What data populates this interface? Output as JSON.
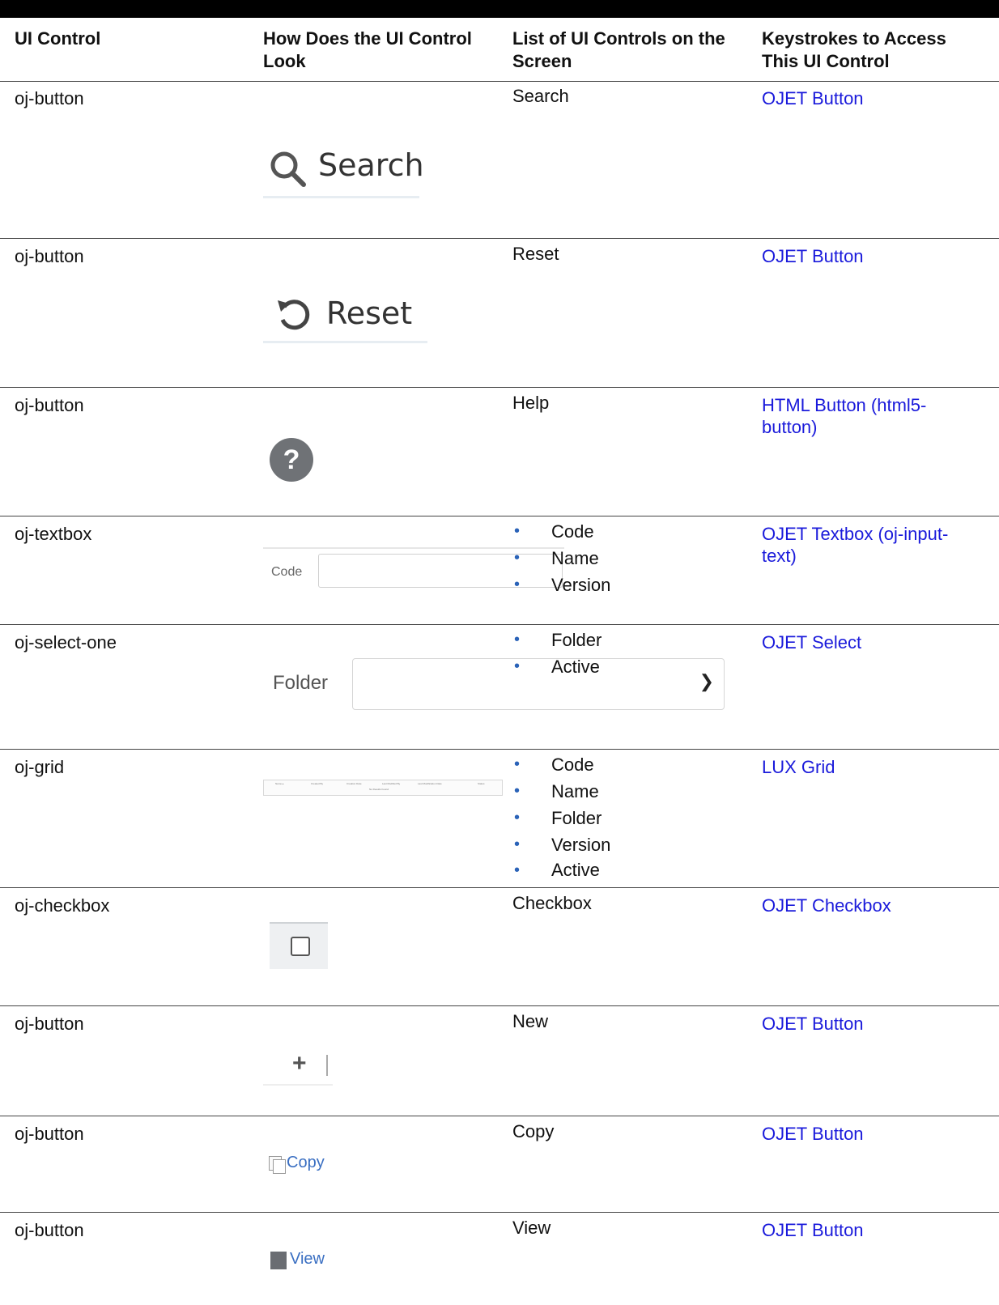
{
  "header": {
    "col1": "UI Control",
    "col2_line1": "How Does the UI Control",
    "col2_line2": "Look",
    "col3_line1": "List of UI Controls on the",
    "col3_line2": "Screen",
    "col4_line1": "Keystrokes to Access",
    "col4_line2": "This UI Control"
  },
  "rows": [
    {
      "control": "oj-button",
      "controls": [
        "Search"
      ],
      "link": "OJET Button",
      "visual_label": "Search",
      "icon": "search-icon"
    },
    {
      "control": "oj-button",
      "controls": [
        "Reset"
      ],
      "link": "OJET Button",
      "visual_label": "Reset",
      "icon": "reset-icon"
    },
    {
      "control": "oj-button",
      "controls": [
        "Help"
      ],
      "link_line1": "HTML Button (html5-",
      "link_line2": "button)",
      "visual_label": "?",
      "icon": "help-icon"
    },
    {
      "control": "oj-textbox",
      "controls": [
        "Code",
        "Name",
        "Version"
      ],
      "link_line1": "OJET Textbox (oj-input-",
      "link_line2": "text)",
      "visual_label": "Code"
    },
    {
      "control": "oj-select-one",
      "controls": [
        "Folder",
        "Active"
      ],
      "link": "OJET Select",
      "visual_label": "Folder",
      "icon": "chevron-down-icon"
    },
    {
      "control": "oj-grid",
      "controls": [
        "Code",
        "Name",
        "Folder",
        "Version",
        "Active"
      ],
      "link": "LUX Grid",
      "grid_headers": [
        "Name ▴",
        "Created By",
        "Creation Date",
        "Last Modified By",
        "Last Modification Date",
        "Status"
      ],
      "grid_empty": "No Results Found"
    },
    {
      "control": "oj-checkbox",
      "controls": [
        "Checkbox"
      ],
      "link": "OJET Checkbox",
      "icon": "checkbox-icon"
    },
    {
      "control": "oj-button",
      "controls": [
        "New"
      ],
      "link": "OJET Button",
      "visual_label": "+",
      "icon": "plus-icon"
    },
    {
      "control": "oj-button",
      "controls": [
        "Copy"
      ],
      "link": "OJET Button",
      "visual_label": "Copy",
      "icon": "copy-icon"
    },
    {
      "control": "oj-button",
      "controls": [
        "View"
      ],
      "link": "OJET Button",
      "visual_label": "View",
      "icon": "view-icon"
    }
  ],
  "colors": {
    "link": "#1a1adb",
    "bullet": "#2b63b8"
  }
}
